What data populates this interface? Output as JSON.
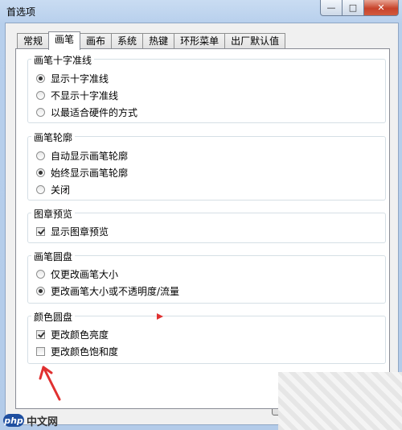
{
  "window": {
    "title": "首选项"
  },
  "controls": {
    "minimize": "—",
    "maximize": "□",
    "close": "✕"
  },
  "tabs": [
    "常规",
    "画笔",
    "画布",
    "系统",
    "热键",
    "环形菜单",
    "出厂默认值"
  ],
  "active_tab": 1,
  "groups": [
    {
      "title": "画笔十字准线",
      "options": [
        {
          "type": "radio",
          "label": "显示十字准线",
          "checked": true
        },
        {
          "type": "radio",
          "label": "不显示十字准线",
          "checked": false
        },
        {
          "type": "radio",
          "label": "以最适合硬件的方式",
          "checked": false
        }
      ]
    },
    {
      "title": "画笔轮廓",
      "options": [
        {
          "type": "radio",
          "label": "自动显示画笔轮廓",
          "checked": false
        },
        {
          "type": "radio",
          "label": "始终显示画笔轮廓",
          "checked": true
        },
        {
          "type": "radio",
          "label": "关闭",
          "checked": false
        }
      ]
    },
    {
      "title": "图章预览",
      "options": [
        {
          "type": "checkbox",
          "label": "显示图章预览",
          "checked": true
        }
      ]
    },
    {
      "title": "画笔圆盘",
      "options": [
        {
          "type": "radio",
          "label": "仅更改画笔大小",
          "checked": false
        },
        {
          "type": "radio",
          "label": "更改画笔大小或不透明度/流量",
          "checked": true
        }
      ]
    },
    {
      "title": "颜色圆盘",
      "options": [
        {
          "type": "checkbox",
          "label": "更改颜色亮度",
          "checked": true
        },
        {
          "type": "checkbox",
          "label": "更改颜色饱和度",
          "checked": false
        }
      ]
    }
  ],
  "annotation": {
    "arrow_color": "#e03030"
  },
  "watermark": {
    "logo": "php",
    "text": "中文网"
  }
}
